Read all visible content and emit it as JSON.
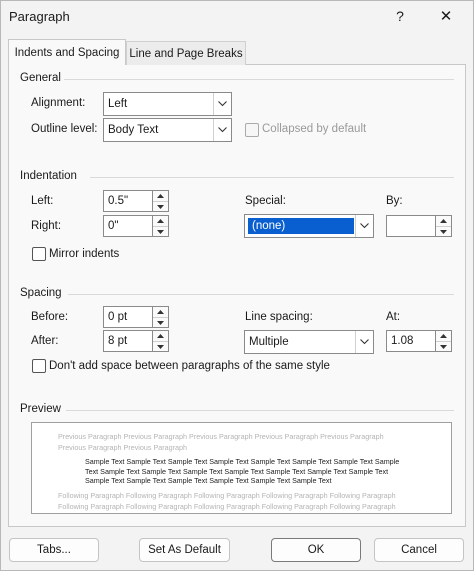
{
  "window": {
    "title": "Paragraph",
    "help_glyph": "?",
    "close_glyph": "✕"
  },
  "tabs": [
    {
      "label": "Indents and Spacing",
      "active": true
    },
    {
      "label": "Line and Page Breaks",
      "active": false
    }
  ],
  "general": {
    "heading": "General",
    "alignment_label": "Alignment:",
    "alignment_value": "Left",
    "outline_label": "Outline level:",
    "outline_value": "Body Text",
    "collapsed_label": "Collapsed by default"
  },
  "indentation": {
    "heading": "Indentation",
    "left_label": "Left:",
    "left_value": "0.5\"",
    "right_label": "Right:",
    "right_value": "0\"",
    "special_label": "Special:",
    "special_value": "(none)",
    "by_label": "By:",
    "by_value": "",
    "mirror_label": "Mirror indents"
  },
  "spacing": {
    "heading": "Spacing",
    "before_label": "Before:",
    "before_value": "0 pt",
    "after_label": "After:",
    "after_value": "8 pt",
    "line_spacing_label": "Line spacing:",
    "line_spacing_value": "Multiple",
    "at_label": "At:",
    "at_value": "1.08",
    "dont_add_label": "Don't add space between paragraphs of the same style"
  },
  "preview": {
    "heading": "Preview",
    "previous_text": "Previous Paragraph Previous Paragraph Previous Paragraph Previous Paragraph Previous Paragraph Previous Paragraph Previous Paragraph",
    "sample_text": "Sample Text Sample Text Sample Text Sample Text Sample Text Sample Text Sample Text Sample Text Sample Text Sample Text Sample Text Sample Text Sample Text Sample Text Sample Text Sample Text Sample Text Sample Text Sample Text Sample Text Sample Text",
    "following_text": "Following Paragraph Following Paragraph Following Paragraph Following Paragraph Following Paragraph Following Paragraph Following Paragraph Following Paragraph Following Paragraph Following Paragraph"
  },
  "buttons": {
    "tabs": "Tabs...",
    "set_default": "Set As Default",
    "ok": "OK",
    "cancel": "Cancel"
  },
  "colors": {
    "selection": "#0a5fd0",
    "dialog_bg": "#f3f3f3",
    "panel_bg": "#f9f9f9"
  },
  "icons": [
    "help-icon",
    "close-icon",
    "chevron-down-icon",
    "spin-up-icon",
    "spin-down-icon"
  ]
}
